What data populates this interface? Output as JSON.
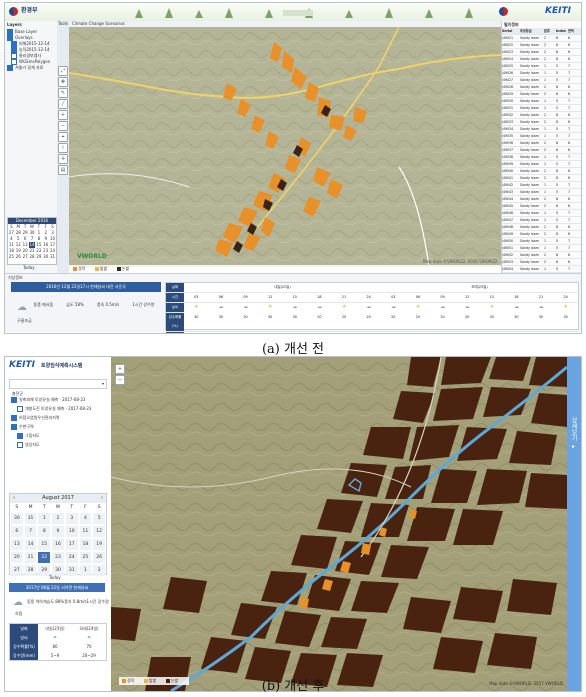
{
  "captions": {
    "before": "(a) 개선 전",
    "after": "(b) 개선 후"
  },
  "before": {
    "header": {
      "ministry_logo_text": "환경부",
      "brand_text": "KEITI"
    },
    "sidebar": {
      "title": "Layers",
      "items": [
        {
          "label": "Base Layer",
          "checked": true
        },
        {
          "label": "Overlays",
          "checked": true
        },
        {
          "label": "피해2015-12-14",
          "checked": true
        },
        {
          "label": "농작2015-12-14",
          "checked": true
        },
        {
          "label": "물리경보앱사",
          "checked": false
        },
        {
          "label": "WGSmsPolygon",
          "checked": false
        },
        {
          "label": "겨울기 경계 자료",
          "checked": true
        }
      ],
      "tools_label": "Tools"
    },
    "map_header": "Climate Change Scenarios",
    "map_badge": "VWORLD",
    "map_credit": "Map data ©VWORLD. 2016 VWORLD",
    "legend": [
      {
        "label": "경작",
        "color": "#e8902a"
      },
      {
        "label": "밭밭",
        "color": "#f2b24a"
      },
      {
        "label": "논밭",
        "color": "#3a2416"
      }
    ],
    "calendar": {
      "month_label": "December 2016",
      "days_header": [
        "S",
        "M",
        "T",
        "W",
        "T",
        "F",
        "S"
      ],
      "days": [
        "27",
        "28",
        "29",
        "30",
        "1",
        "2",
        "3",
        "4",
        "5",
        "6",
        "7",
        "8",
        "9",
        "10",
        "11",
        "12",
        "13",
        "14",
        "15",
        "16",
        "17",
        "18",
        "19",
        "20",
        "21",
        "22",
        "23",
        "24",
        "25",
        "26",
        "27",
        "28",
        "29",
        "30",
        "31"
      ],
      "selected_day": "14",
      "today_label": "Today"
    },
    "right_panel": {
      "title": "필지정보",
      "columns": [
        "Serial",
        "토양등급",
        "분류",
        "Index",
        "면적"
      ],
      "rows": [
        [
          "J49021",
          "Sandy loam",
          "2",
          "8",
          "6"
        ],
        [
          "J49022",
          "Sandy loam",
          "2",
          "8",
          "6"
        ],
        [
          "J49023",
          "Sandy loam",
          "2",
          "8",
          "6"
        ],
        [
          "J49024",
          "Sandy loam",
          "2",
          "8",
          "6"
        ],
        [
          "J49025",
          "Sandy loam",
          "1",
          "5",
          "7"
        ],
        [
          "J49026",
          "Sandy loam",
          "1",
          "5",
          "7"
        ],
        [
          "J49027",
          "Sandy loam",
          "1",
          "5",
          "7"
        ],
        [
          "J49028",
          "Sandy loam",
          "2",
          "8",
          "6"
        ],
        [
          "J49029",
          "Sandy loam",
          "2",
          "8",
          "6"
        ],
        [
          "J49030",
          "Sandy loam",
          "1",
          "5",
          "7"
        ],
        [
          "J49031",
          "Sandy loam",
          "1",
          "5",
          "7"
        ],
        [
          "J49032",
          "Sandy loam",
          "2",
          "8",
          "6"
        ],
        [
          "J49033",
          "Sandy loam",
          "2",
          "8",
          "6"
        ],
        [
          "J49034",
          "Sandy loam",
          "1",
          "5",
          "7"
        ],
        [
          "J49035",
          "Sandy loam",
          "1",
          "5",
          "7"
        ],
        [
          "J49036",
          "Sandy loam",
          "2",
          "8",
          "6"
        ],
        [
          "J49037",
          "Sandy loam",
          "2",
          "8",
          "6"
        ],
        [
          "J49038",
          "Sandy loam",
          "1",
          "5",
          "7"
        ],
        [
          "J49039",
          "Sandy loam",
          "1",
          "5",
          "7"
        ],
        [
          "J49040",
          "Sandy loam",
          "2",
          "8",
          "6"
        ],
        [
          "J49041",
          "Sandy loam",
          "2",
          "8",
          "6"
        ],
        [
          "J49042",
          "Sandy loam",
          "1",
          "5",
          "7"
        ],
        [
          "J49043",
          "Sandy loam",
          "1",
          "5",
          "7"
        ],
        [
          "J49044",
          "Sandy loam",
          "2",
          "8",
          "6"
        ],
        [
          "J49045",
          "Sandy loam",
          "2",
          "8",
          "6"
        ],
        [
          "J49046",
          "Sandy loam",
          "1",
          "5",
          "7"
        ],
        [
          "J49047",
          "Sandy loam",
          "1",
          "5",
          "7"
        ],
        [
          "J49048",
          "Sandy loam",
          "2",
          "8",
          "6"
        ],
        [
          "J49049",
          "Sandy loam",
          "2",
          "8",
          "6"
        ],
        [
          "J49050",
          "Sandy loam",
          "1",
          "5",
          "7"
        ],
        [
          "J49051",
          "Sandy loam",
          "1",
          "5",
          "7"
        ],
        [
          "J49052",
          "Sandy loam",
          "2",
          "8",
          "6"
        ],
        [
          "J49053",
          "Sandy loam",
          "2",
          "8",
          "6"
        ],
        [
          "J49054",
          "Sandy loam",
          "1",
          "5",
          "7"
        ],
        [
          "J49055",
          "Sandy loam",
          "1",
          "5",
          "7"
        ],
        [
          "J49056",
          "Sandy loam",
          "2",
          "8",
          "6"
        ]
      ]
    },
    "bottom": {
      "panel_title": "기상정보",
      "forecast_title": "2016년 12월 22일17시 현재날씨 대전 서운곡",
      "summary_labels": [
        "구름조금",
        "동풍 매서움",
        "습도 58%",
        "풍속 0.5m/s",
        "1시간 강수량"
      ],
      "weather_row_labels": [
        "날짜",
        "시간",
        "날씨",
        "강수확률(%)",
        "강수량(mm)"
      ],
      "day_labels": [
        "내일(22일)",
        "모레(23일)"
      ],
      "hours": [
        "03",
        "06",
        "09",
        "12",
        "15",
        "18",
        "21",
        "24",
        "03",
        "06",
        "09",
        "12",
        "15",
        "18",
        "21",
        "24"
      ],
      "pops": [
        "30",
        "30",
        "30",
        "30",
        "30",
        "20",
        "20",
        "20",
        "20",
        "20",
        "20",
        "20",
        "30",
        "30",
        "30",
        "30"
      ],
      "rain": [
        "0.4",
        "-",
        "1.0",
        "-",
        "-",
        "-",
        "-",
        "-",
        "-",
        "-",
        "-",
        "-",
        "-",
        "-",
        "-",
        "-"
      ]
    }
  },
  "after": {
    "header": {
      "brand_text": "KEITI",
      "app_title": "토양침식예측시스템"
    },
    "region_select": "충전군",
    "layers": [
      {
        "label": "일축피해 토양유실 예측 · 2017-08-23",
        "checked": true
      },
      {
        "label": "개발도진 토양유실 예측 · 2017-08-23",
        "checked": false
      },
      {
        "label": "비점오염원우선관리지역",
        "checked": true
      },
      {
        "label": "수변구역",
        "checked": true
      },
      {
        "label": "그림지도",
        "checked": true
      },
      {
        "label": "영상지도",
        "checked": false
      }
    ],
    "calendar": {
      "month_label": "August 2017",
      "days_header": [
        "S",
        "M",
        "T",
        "W",
        "T",
        "F",
        "S"
      ],
      "days": [
        "30",
        "31",
        "1",
        "2",
        "3",
        "4",
        "5",
        "6",
        "7",
        "8",
        "9",
        "10",
        "11",
        "12",
        "13",
        "14",
        "15",
        "16",
        "17",
        "18",
        "19",
        "20",
        "21",
        "22",
        "23",
        "24",
        "25",
        "26",
        "27",
        "28",
        "29",
        "30",
        "31",
        "1",
        "2"
      ],
      "selected_day": "22",
      "today_label": "Today"
    },
    "forecast_title": "2017년 08월 22일 서석면 현재날씨",
    "summary_labels": [
      "흐림",
      "동풍 약하게",
      "습도 88%",
      "풍속 0.8m/s",
      "1시간 강수량"
    ],
    "table": {
      "row_labels": [
        "날짜",
        "날씨",
        "강수확률(%)",
        "강수량(mm)"
      ],
      "day_labels": [
        "내일(23일)",
        "모레(24일)"
      ],
      "pop": [
        "80",
        "70"
      ],
      "rain": [
        "5~9",
        "20~29"
      ]
    },
    "legend": [
      {
        "label": "경작",
        "color": "#e8902a"
      },
      {
        "label": "밭밭",
        "color": "#f2b24a"
      },
      {
        "label": "논밭",
        "color": "#3a2416"
      }
    ],
    "side_tab_label": "상세보기 ▸",
    "map_credit": "Map data ©VWORLD. 2017 VWORLD"
  },
  "colors": {
    "dark_parcel": "#4a2210",
    "orange_parcel": "#e8902a",
    "river": "#5ba9d6",
    "map_bg_before": "#b4b596",
    "map_bg_after": "#a39f78",
    "nav_blue": "#2c4a7a",
    "tab_blue": "#6aa4e0"
  }
}
